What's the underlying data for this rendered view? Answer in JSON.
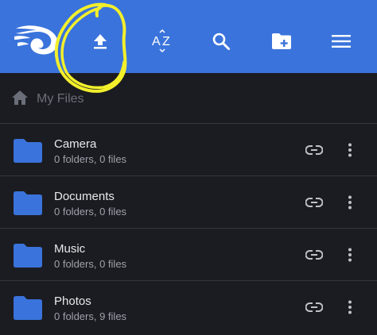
{
  "toolbar": {
    "background": "#3a73db",
    "logo_icon": "flame-logo-icon",
    "upload_icon": "upload-icon",
    "sort_icon": "sort-az-icon",
    "search_icon": "search-icon",
    "new_folder_icon": "new-folder-icon",
    "menu_icon": "menu-icon"
  },
  "breadcrumb": {
    "icon": "home-icon",
    "label": "My Files"
  },
  "folders": [
    {
      "name": "Camera",
      "meta": "0 folders, 0 files"
    },
    {
      "name": "Documents",
      "meta": "0 folders, 0 files"
    },
    {
      "name": "Music",
      "meta": "0 folders, 0 files"
    },
    {
      "name": "Photos",
      "meta": "0 folders, 9 files"
    }
  ],
  "colors": {
    "folder": "#3a73db",
    "highlight": "#f2ef2c"
  }
}
